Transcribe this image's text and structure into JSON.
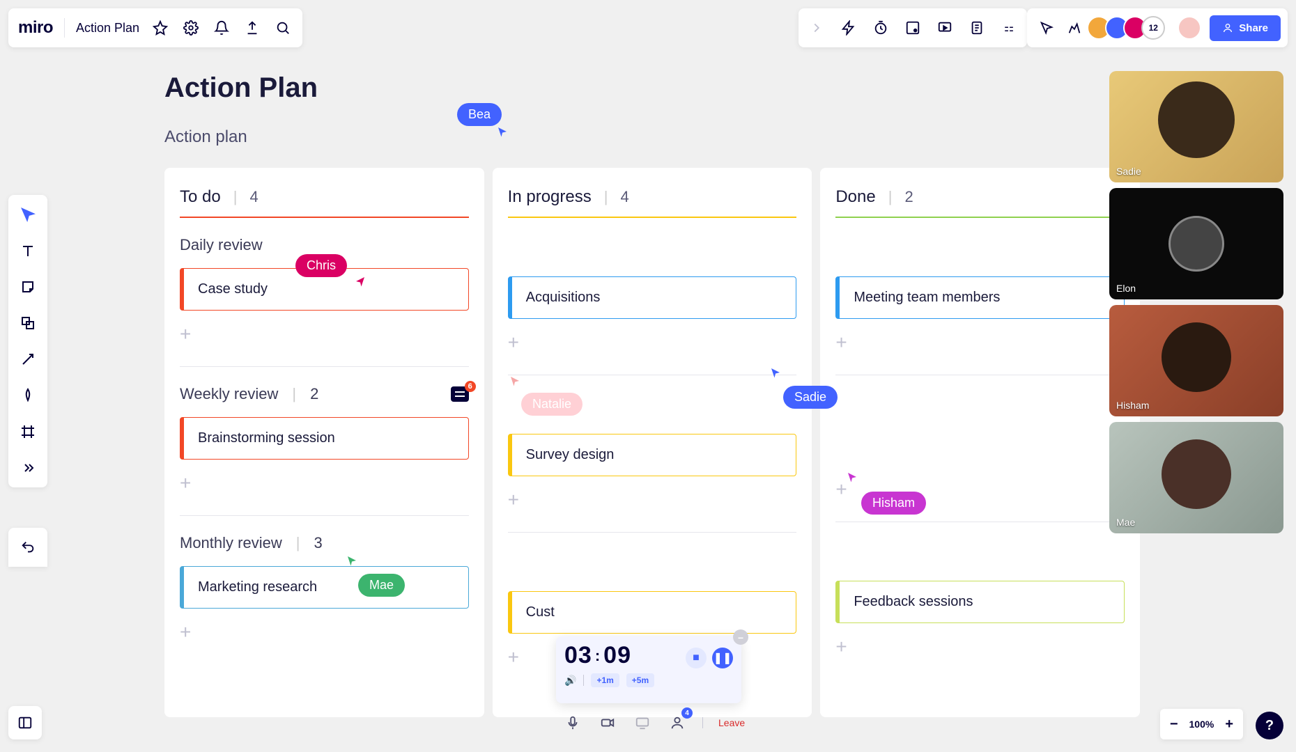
{
  "header": {
    "logo": "miro",
    "board_name": "Action Plan"
  },
  "presence": {
    "count": "12",
    "share_label": "Share",
    "avatars": [
      {
        "bg": "#f2a73b"
      },
      {
        "bg": "#4262ff"
      },
      {
        "bg": "#da0063"
      }
    ],
    "facilitator_bg": "#f7c6c2"
  },
  "board": {
    "title": "Action Plan",
    "subtitle": "Action plan",
    "columns": [
      {
        "title": "To do",
        "count": "4",
        "rule": "rule-red",
        "sections": [
          {
            "label": "Daily review",
            "count": null,
            "comments": null,
            "cards": [
              {
                "text": "Case study",
                "cls": "card-red"
              }
            ]
          },
          {
            "label": "Weekly review",
            "count": "2",
            "comments": "6",
            "cards": [
              {
                "text": "Brainstorming session",
                "cls": "card-red"
              }
            ]
          },
          {
            "label": "Monthly review",
            "count": "3",
            "comments": null,
            "cards": [
              {
                "text": "Marketing research",
                "cls": "card-azure"
              }
            ]
          }
        ]
      },
      {
        "title": "In progress",
        "count": "4",
        "rule": "rule-yellow",
        "sections": [
          {
            "label": null,
            "cards": [
              {
                "text": "Acquisitions",
                "cls": "card-blue"
              }
            ]
          },
          {
            "label": null,
            "cards": [
              {
                "text": "Survey design",
                "cls": "card-yellow"
              }
            ]
          },
          {
            "label": null,
            "cards": [
              {
                "text": "Cust",
                "cls": "card-yellow"
              }
            ]
          }
        ]
      },
      {
        "title": "Done",
        "count": "2",
        "rule": "rule-green",
        "sections": [
          {
            "label": null,
            "cards": [
              {
                "text": "Meeting team members",
                "cls": "card-blue"
              }
            ]
          },
          {
            "label": null,
            "cards": []
          },
          {
            "label": null,
            "cards": [
              {
                "text": "Feedback sessions",
                "cls": "card-lgreen"
              }
            ]
          }
        ]
      }
    ]
  },
  "cursors": {
    "bea": "Bea",
    "chris": "Chris",
    "natalie": "Natalie",
    "sadie": "Sadie",
    "mae": "Mae",
    "hisham": "Hisham"
  },
  "video": [
    {
      "name": "Sadie",
      "bg": "linear-gradient(135deg,#d9a85c,#c28f47)"
    },
    {
      "name": "Elon",
      "bg": "#0a0a0a",
      "circle": true
    },
    {
      "name": "Hisham",
      "bg": "linear-gradient(135deg,#b85c3e,#8a3f28)"
    },
    {
      "name": "Mae",
      "bg": "linear-gradient(135deg,#8aa89c,#6a8678)"
    }
  ],
  "timer": {
    "mm": "03",
    "ss": "09",
    "plus1": "+1m",
    "plus5": "+5m"
  },
  "call": {
    "leave": "Leave",
    "viewers": "4"
  },
  "zoom": {
    "level": "100%"
  }
}
